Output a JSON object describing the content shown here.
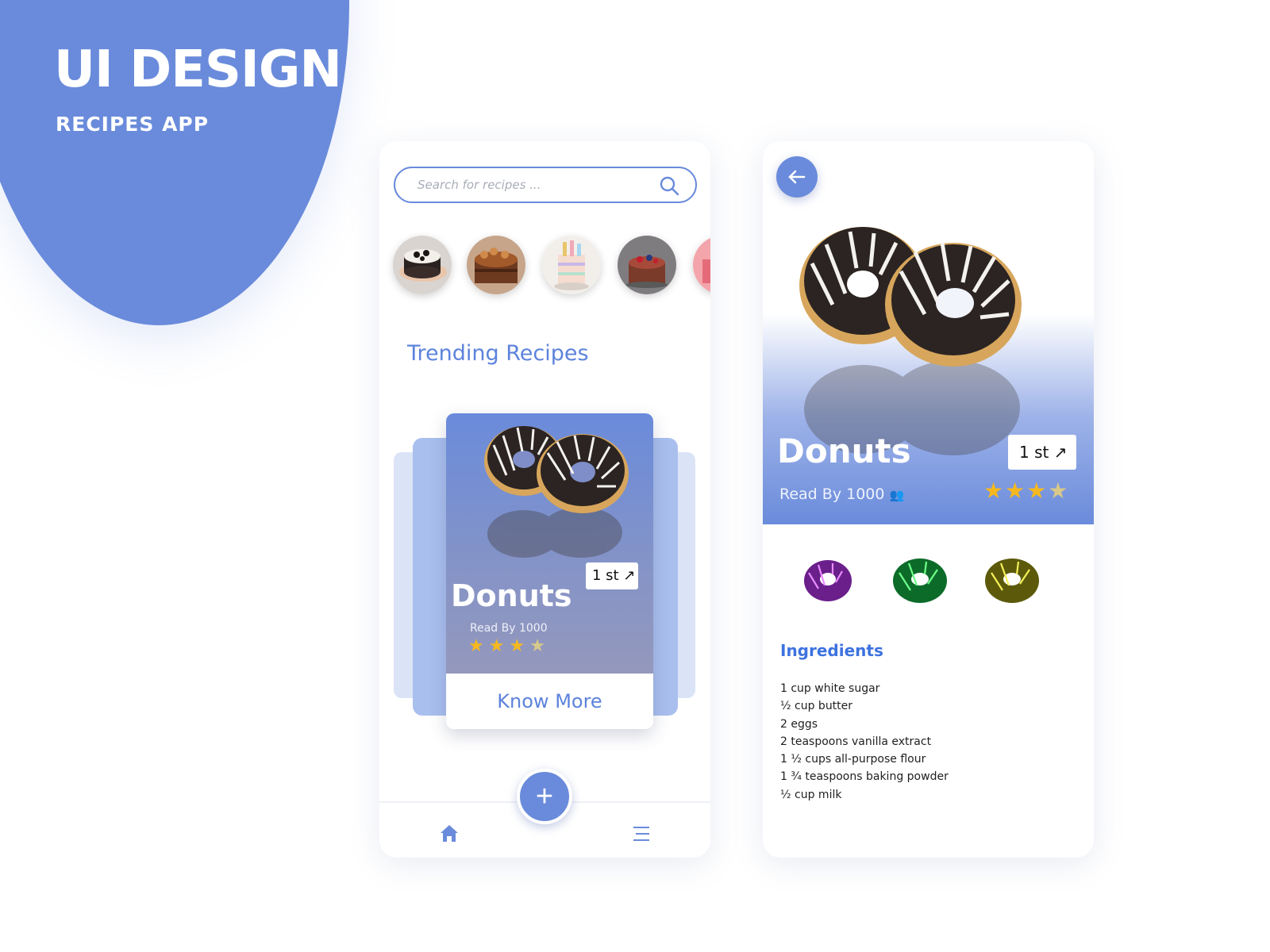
{
  "hero": {
    "title": "UI DESIGN",
    "subtitle": "RECIPES APP"
  },
  "colors": {
    "accent": "#6a8bdb",
    "title_blue": "#5d83dc",
    "ingredients_blue": "#3d72e0",
    "star": "#f6b81f",
    "white": "#ffffff"
  },
  "home": {
    "search": {
      "placeholder": "Search for recipes ...",
      "icon": "search-icon"
    },
    "categories": [
      "oreo-cake-thumb",
      "chocolate-cake-thumb",
      "birthday-cake-thumb",
      "berry-cake-thumb",
      "pink-cake-thumb"
    ],
    "section_title": "Trending Recipes",
    "card": {
      "name": "Donuts",
      "rank": "1 st",
      "read_by": "Read By 1000",
      "rating": 3.5,
      "rating_max": 4,
      "cta": "Know More"
    },
    "nav": {
      "fab": "+",
      "home_icon": "home-icon",
      "menu_icon": "menu-icon"
    }
  },
  "detail": {
    "back_icon": "arrow-left-icon",
    "name": "Donuts",
    "rank": "1 st",
    "read_by": "Read By 1000",
    "rating": 3,
    "rating_max": 4,
    "variants": [
      "purple-glaze",
      "green-glaze",
      "yellow-glaze"
    ],
    "ingredients_title": "Ingredients",
    "ingredients": [
      "1 cup white sugar",
      "½ cup butter",
      "2 eggs",
      "2 teaspoons vanilla extract",
      "1 ½ cups all-purpose flour",
      "1 ¾ teaspoons baking powder",
      "½ cup milk"
    ]
  }
}
